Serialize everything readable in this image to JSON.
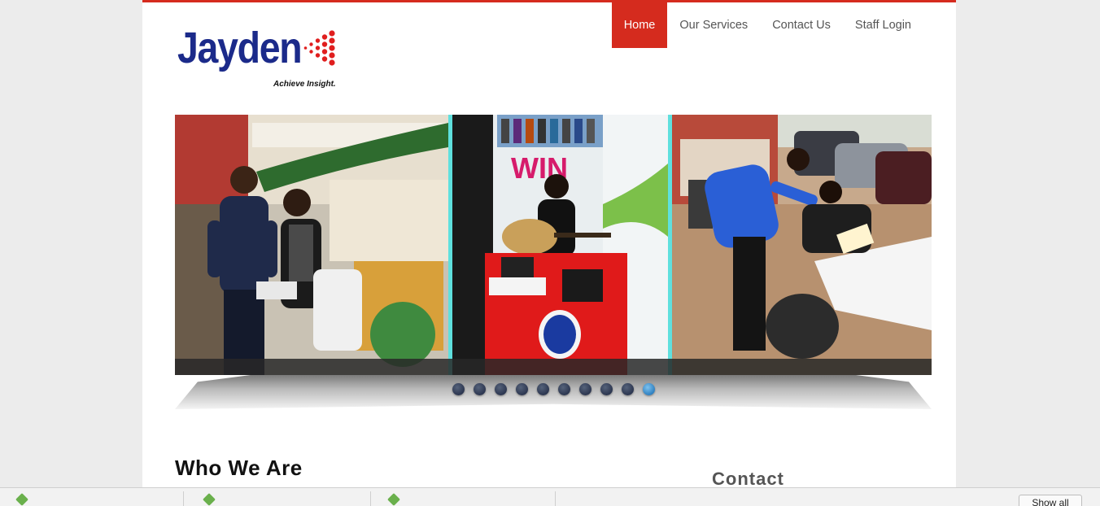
{
  "brand": {
    "name": "Jayden",
    "tagline": "Achieve Insight.",
    "colors": {
      "brand_blue": "#1b2a8a",
      "accent_red": "#d52b1e",
      "divider_cyan": "#5fe0de"
    }
  },
  "nav": {
    "items": [
      {
        "label": "Home",
        "active": true
      },
      {
        "label": "Our Services",
        "active": false
      },
      {
        "label": "Contact Us",
        "active": false
      },
      {
        "label": "Staff Login",
        "active": false
      }
    ]
  },
  "slider": {
    "slide_count": 10,
    "active_index": 9,
    "panels": [
      {
        "icon": "promoters-at-mall-photo"
      },
      {
        "icon": "guitarist-promo-booth-photo",
        "visible_text": "WIN"
      },
      {
        "icon": "outdoor-survey-photo"
      }
    ]
  },
  "sections": {
    "who_we_are": "Who We Are",
    "contact": "Contact"
  },
  "downloads_bar": {
    "show_all_label": "Show all"
  }
}
